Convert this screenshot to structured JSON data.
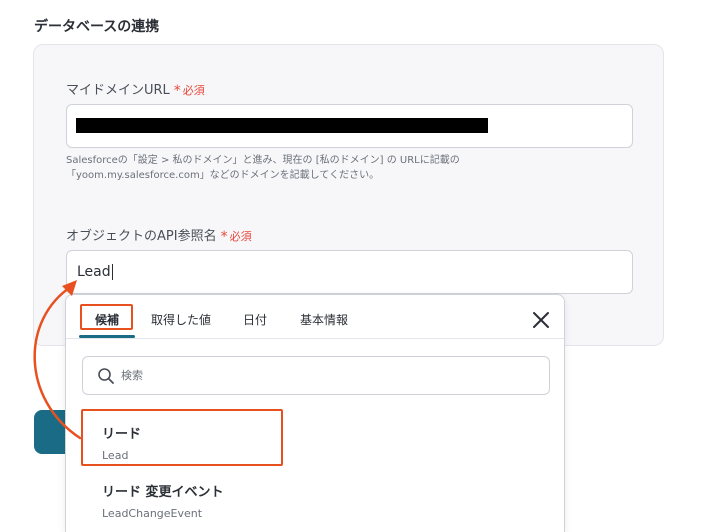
{
  "section_title": "データベースの連携",
  "required_label": "必須",
  "required_mark": "*",
  "domain_field": {
    "label": "マイドメインURL",
    "help_line1": "Salesforceの「設定 > 私のドメイン」と進み、現在の [私のドメイン] の URLに記載の",
    "help_line2": "「yoom.my.salesforce.com」などのドメインを記載してください。"
  },
  "object_field": {
    "label": "オブジェクトのAPI参照名",
    "value": "Lead"
  },
  "dropdown": {
    "tabs": [
      "候補",
      "取得した値",
      "日付",
      "基本情報"
    ],
    "active_tab": "候補",
    "search_placeholder": "検索",
    "options": [
      {
        "name": "リード",
        "api": "Lead"
      },
      {
        "name": "リード 変更イベント",
        "api": "LeadChangeEvent"
      }
    ]
  },
  "colors": {
    "accent": "#1a6c86",
    "required": "#e8473a",
    "annotation": "#e8511f"
  },
  "icons": {
    "close": "close-icon",
    "search": "search-icon"
  }
}
